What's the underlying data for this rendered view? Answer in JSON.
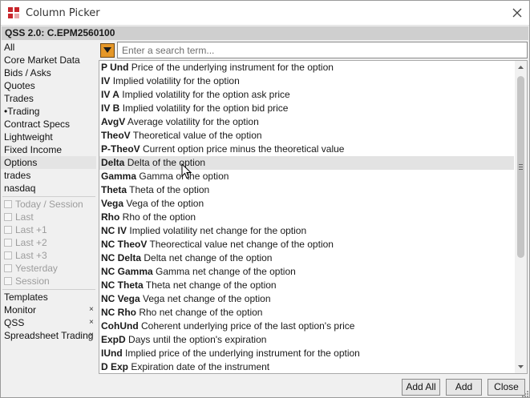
{
  "window": {
    "title": "Column Picker",
    "header": "QSS 2.0: C.EPM2560100"
  },
  "sidebar": {
    "categories": [
      {
        "label": "All"
      },
      {
        "label": "Core Market Data"
      },
      {
        "label": "Bids / Asks"
      },
      {
        "label": "Quotes"
      },
      {
        "label": "Trades"
      },
      {
        "label": "•Trading"
      },
      {
        "label": "Contract Specs"
      },
      {
        "label": "Lightweight"
      },
      {
        "label": "Fixed Income"
      },
      {
        "label": "Options"
      },
      {
        "label": "trades"
      },
      {
        "label": "nasdaq"
      }
    ],
    "selected": "Options",
    "sessions": [
      {
        "label": "Today / Session"
      },
      {
        "label": "Last"
      },
      {
        "label": "Last +1"
      },
      {
        "label": "Last +2"
      },
      {
        "label": "Last +3"
      },
      {
        "label": "Yesterday"
      },
      {
        "label": "Session"
      }
    ],
    "templates_label": "Templates",
    "templates": [
      {
        "label": "Monitor"
      },
      {
        "label": "QSS"
      },
      {
        "label": "Spreadsheet Trading"
      }
    ],
    "remove_glyph": "×"
  },
  "search": {
    "placeholder": "Enter a search term...",
    "value": ""
  },
  "columns": [
    {
      "code": "P Und",
      "desc": "Price of the underlying instrument for the option"
    },
    {
      "code": "IV",
      "desc": "Implied volatility for the option"
    },
    {
      "code": "IV A",
      "desc": "Implied volatility for the option ask price"
    },
    {
      "code": "IV B",
      "desc": "Implied volatility for the option bid price"
    },
    {
      "code": "AvgV",
      "desc": "Average volatility for the option"
    },
    {
      "code": "TheoV",
      "desc": "Theoretical value of the option"
    },
    {
      "code": "P-TheoV",
      "desc": "Current option price minus the theoretical value"
    },
    {
      "code": "Delta",
      "desc": "Delta of the option"
    },
    {
      "code": "Gamma",
      "desc": "Gamma of the option"
    },
    {
      "code": "Theta",
      "desc": "Theta of the option"
    },
    {
      "code": "Vega",
      "desc": "Vega of the option"
    },
    {
      "code": "Rho",
      "desc": "Rho of the option"
    },
    {
      "code": "NC IV",
      "desc": "Implied volatility net change for the option"
    },
    {
      "code": "NC TheoV",
      "desc": "Theorectical value net change of the option"
    },
    {
      "code": "NC Delta",
      "desc": "Delta net change of the option"
    },
    {
      "code": "NC Gamma",
      "desc": "Gamma net change of the option"
    },
    {
      "code": "NC Theta",
      "desc": "Theta net change of the option"
    },
    {
      "code": "NC Vega",
      "desc": "Vega net change of the option"
    },
    {
      "code": "NC Rho",
      "desc": "Rho net change of the option"
    },
    {
      "code": "CohUnd",
      "desc": "Coherent underlying price of the last option's price"
    },
    {
      "code": "ExpD",
      "desc": "Days until the option's expiration"
    },
    {
      "code": "IUnd",
      "desc": "Implied price of the underlying instrument for the option"
    },
    {
      "code": "D Exp",
      "desc": "Expiration date of the instrument"
    }
  ],
  "hovered_column": "Delta",
  "buttons": {
    "add_all": "Add All",
    "add": "Add",
    "close": "Close"
  },
  "colors": {
    "filter_button": "#e59728",
    "header_bar": "#cfcfcf",
    "hover_row": "#e3e3e3",
    "app_icon": "#c8262c"
  },
  "icons": {
    "app": "app-logo-icon",
    "close": "close-icon",
    "filter": "filter-icon",
    "scroll_up": "chevron-up-icon",
    "scroll_down": "chevron-down-icon",
    "resize": "resize-grip-icon",
    "pointer": "mouse-pointer-icon"
  }
}
